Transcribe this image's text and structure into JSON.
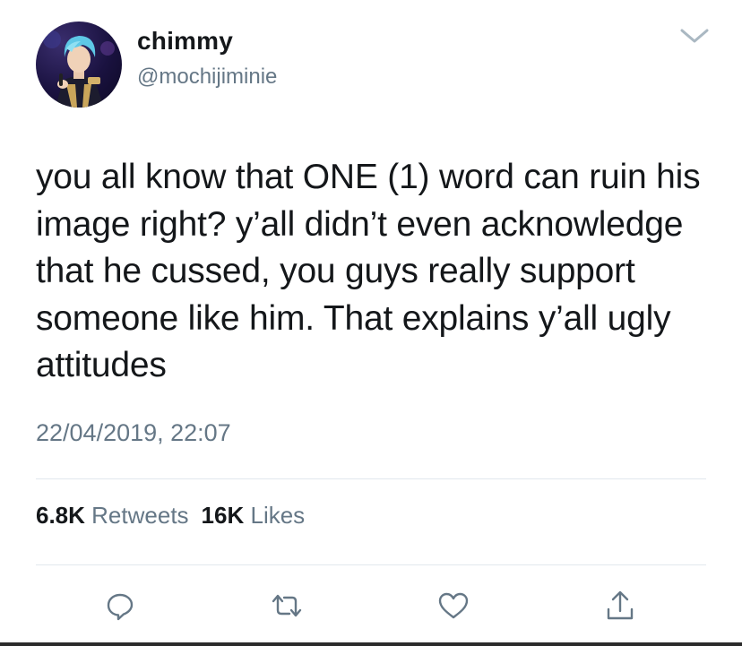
{
  "user": {
    "display_name": "chimmy",
    "handle": "@mochijiminie",
    "avatar_icon": "profile-photo"
  },
  "tweet": {
    "text": "you all know that ONE (1) word can ruin his image right? y’all didn’t even acknowledge that he cussed, you guys really support someone like him. That explains y’all ugly attitudes",
    "timestamp": "22/04/2019, 22:07"
  },
  "stats": {
    "retweets_count": "6.8K",
    "retweets_label": "Retweets",
    "likes_count": "16K",
    "likes_label": "Likes"
  },
  "actions": [
    {
      "name": "reply",
      "icon": "reply-icon"
    },
    {
      "name": "retweet",
      "icon": "retweet-icon"
    },
    {
      "name": "like",
      "icon": "heart-icon"
    },
    {
      "name": "share",
      "icon": "share-icon"
    }
  ],
  "menu_icon": "chevron-down-icon",
  "colors": {
    "text": "#14171a",
    "secondary": "#657786",
    "divider": "#e1e8ed",
    "avatar_hair": "#5ec8e6"
  }
}
